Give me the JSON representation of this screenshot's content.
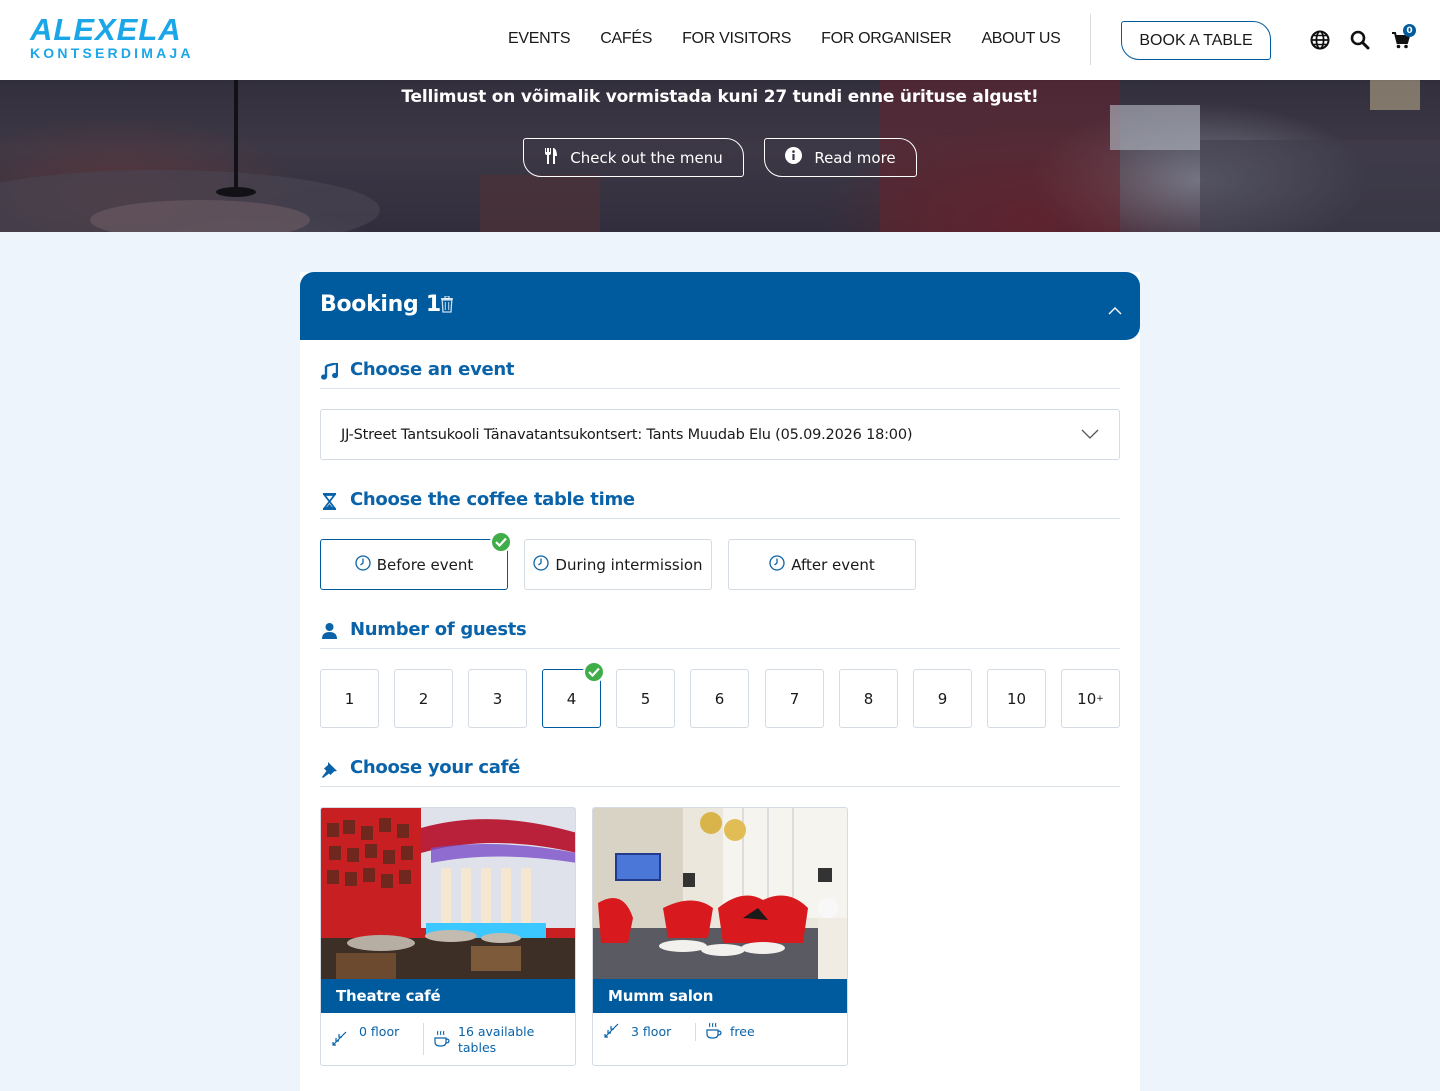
{
  "header": {
    "logo_main": "ALEXELA",
    "logo_sub": "KONTSERDIMAJA",
    "nav": [
      "EVENTS",
      "CAFÉS",
      "FOR VISITORS",
      "FOR ORGANISER",
      "ABOUT US"
    ],
    "book_button": "BOOK A TABLE",
    "cart_count": "0"
  },
  "hero": {
    "notice": "Tellimust on võimalik vormistada kuni 27 tundi enne ürituse algust!",
    "menu_button": "Check out the menu",
    "read_more_button": "Read more"
  },
  "booking": {
    "title": "Booking 1",
    "event_section": "Choose an event",
    "selected_event": "JJ-Street Tantsukooli Tänavatantsukontsert: Tants Muudab Elu (05.09.2026 18:00)",
    "time_section": "Choose the coffee table time",
    "time_options": [
      "Before event",
      "During intermission",
      "After event"
    ],
    "selected_time": "Before event",
    "guests_section": "Number of guests",
    "guest_options": [
      "1",
      "2",
      "3",
      "4",
      "5",
      "6",
      "7",
      "8",
      "9",
      "10",
      "10"
    ],
    "guest_plus": "+",
    "selected_guests": "4",
    "cafe_section": "Choose your café",
    "cafes": [
      {
        "name": "Theatre café",
        "floor": "0 floor",
        "tables": "16 available tables"
      },
      {
        "name": "Mumm salon",
        "floor": "3 floor",
        "tables": "free"
      }
    ]
  },
  "colors": {
    "brand_blue": "#005a9e",
    "logo_blue": "#1ba6e8",
    "check_green": "#3fae49",
    "page_bg": "#eef4fb"
  },
  "icons": [
    "globe-icon",
    "search-icon",
    "cart-icon",
    "cutlery-icon",
    "info-icon",
    "trash-icon",
    "chevron-up-icon",
    "music-note-icon",
    "hourglass-icon",
    "clock-icon",
    "person-icon",
    "pin-icon",
    "chevron-down-icon",
    "check-icon",
    "stairs-icon",
    "coffee-icon"
  ]
}
